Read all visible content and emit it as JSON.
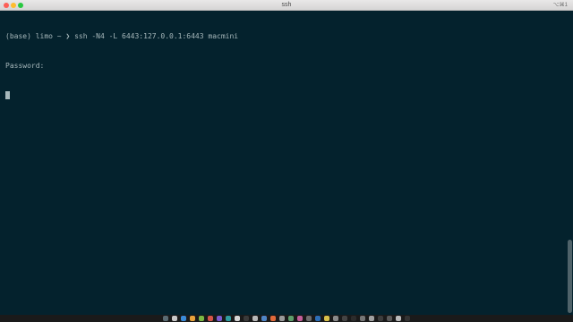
{
  "window": {
    "title": "ssh",
    "shortcut": "⌥⌘1",
    "colors": {
      "background": "#04222d",
      "text": "#a7b8bb",
      "titlebar": "#e2e1e1"
    }
  },
  "terminal": {
    "lines": [
      "(base) limo ~ ❯ ssh -N4 -L 6443:127.0.0.1:6443 macmini",
      "Password:"
    ],
    "cursor": true
  },
  "dock": {
    "icon_colors": [
      "#5a6b73",
      "#c9c9c9",
      "#3a8bd8",
      "#e8a33b",
      "#7bb843",
      "#d4544a",
      "#7a5bd1",
      "#2e9c9f",
      "#d6d6d6",
      "#3a3a3a",
      "#b8b8b8",
      "#4f86c6",
      "#e06a3b",
      "#9a9a9a",
      "#5d9e6b",
      "#c35e9a",
      "#6d6d6d",
      "#2d6fb7",
      "#d8c04a",
      "#8a8a8a",
      "#444444",
      "#2c2c2c",
      "#777777",
      "#a2a2a2",
      "#3d3d3d",
      "#5a5a5a",
      "#bcbcbc",
      "#333333"
    ]
  }
}
